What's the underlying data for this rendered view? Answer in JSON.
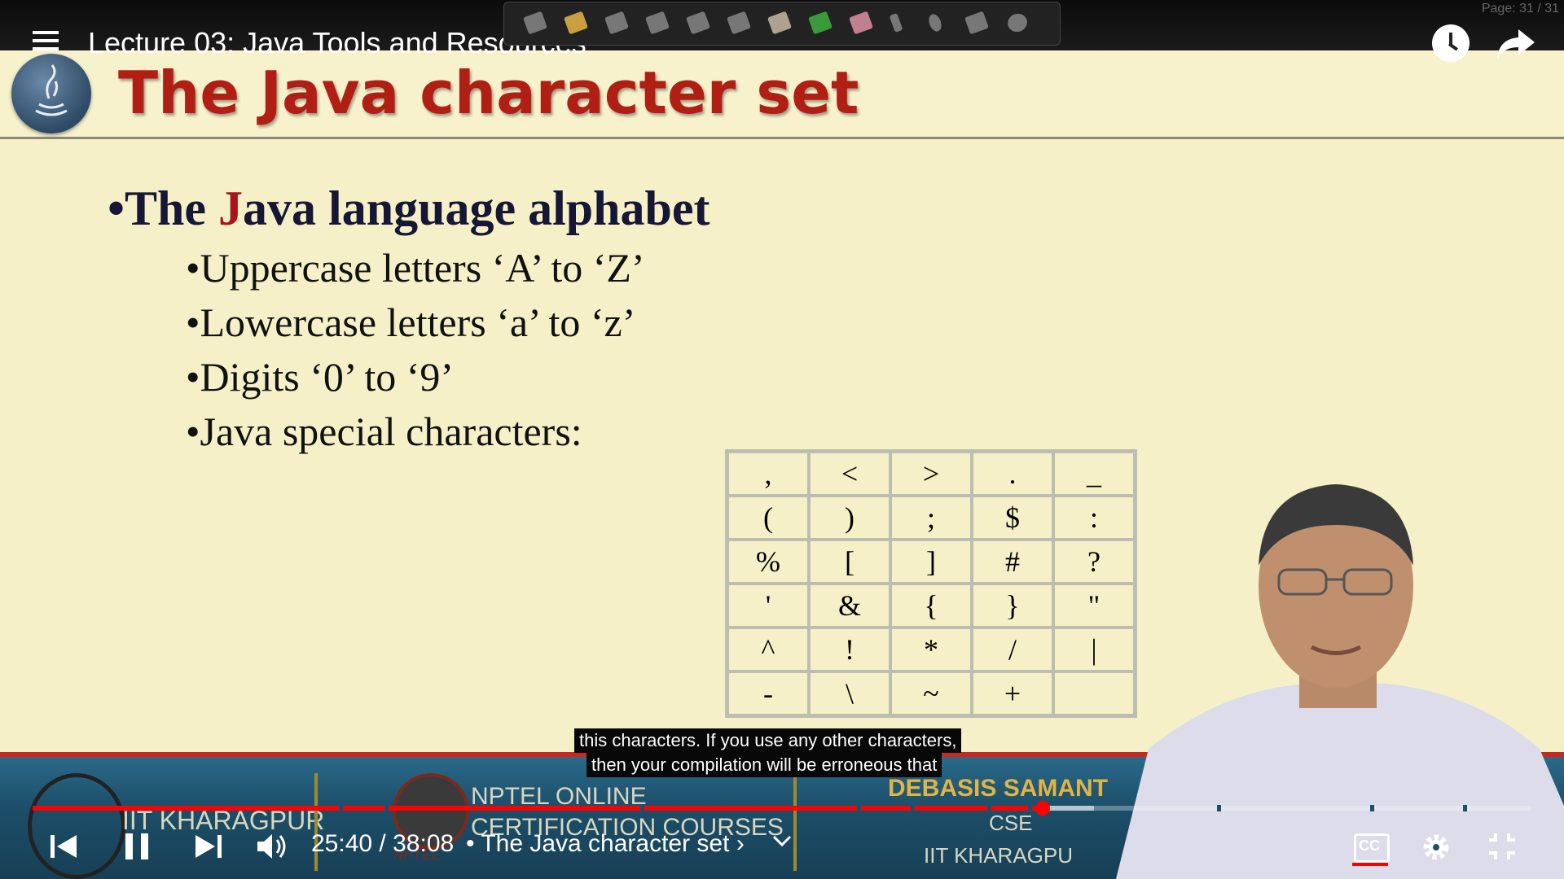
{
  "top_bar": {
    "video_title": "Lecture 03: Java Tools and Resources",
    "page_indicator": "Page: 31 / 31"
  },
  "slide": {
    "title": "The Java character set",
    "heading_bullet": "•",
    "heading_start": "The ",
    "heading_highlight": "J",
    "heading_rest": "ava language alphabet",
    "bullets": [
      "•Uppercase letters ‘A’ to ‘Z’",
      "•Lowercase letters ‘a’ to ‘z’",
      "•Digits ‘0’ to ‘9’",
      "•Java special characters:"
    ],
    "special_chars": [
      [
        ",",
        "<",
        ">",
        ".",
        "_"
      ],
      [
        "(",
        ")",
        ";",
        "$",
        ":"
      ],
      [
        "%",
        "[",
        "]",
        "#",
        "?"
      ],
      [
        "'",
        "&",
        "{",
        "}",
        "\""
      ],
      [
        "^",
        "!",
        "*",
        "/",
        "|"
      ],
      [
        "-",
        "\\",
        "~",
        "+",
        ""
      ]
    ]
  },
  "banner": {
    "institute": "IIT KHARAGPUR",
    "nptel_line1": "NPTEL ONLINE",
    "nptel_line2": "CERTIFICATION COURSES",
    "nptel_small": "NPTEL",
    "presenter_name": "DEBASIS SAMANT",
    "department": "CSE",
    "presenter_institute": "IIT KHARAGPU"
  },
  "captions": {
    "line1": "this characters. If you use any other characters,",
    "line2": "then your compilation will be erroneous that"
  },
  "player": {
    "current_time": "25:40",
    "time_separator": "/",
    "duration": "38:08",
    "chapter_bullet": "•",
    "chapter_title": "The Java character set",
    "chapter_arrow": "›",
    "progress_fraction": 0.674,
    "buffered_fraction": 0.708
  },
  "colors": {
    "progress": "#ff0000",
    "title_red": "#b01e14",
    "slide_bg": "#f6f0c8",
    "banner_blue": "#1d4f6a"
  },
  "icons": [
    "menu-icon",
    "clock-icon",
    "share-icon",
    "previous-icon",
    "pause-icon",
    "next-icon",
    "volume-icon",
    "chevron-down-icon",
    "cc-icon",
    "gear-icon",
    "exit-fullscreen-icon"
  ]
}
